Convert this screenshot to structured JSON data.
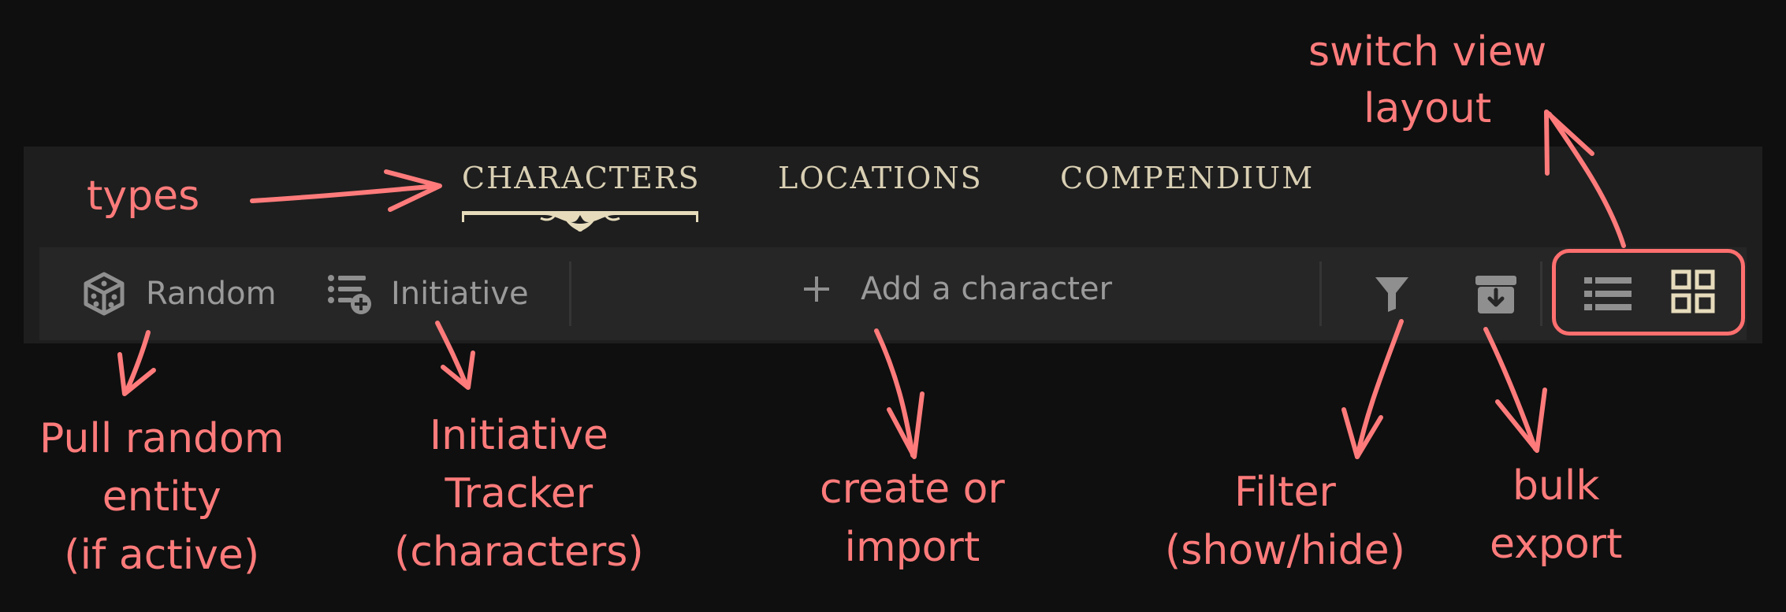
{
  "tabs": {
    "characters": "CHARACTERS",
    "locations": "LOCATIONS",
    "compendium": "COMPENDIUM",
    "active": "characters"
  },
  "toolbar": {
    "random_label": "Random",
    "initiative_label": "Initiative",
    "add_label": "Add a character",
    "icons": {
      "random": "dice-icon",
      "initiative": "list-plus-icon",
      "add": "plus-icon",
      "filter": "filter-icon",
      "export": "archive-download-icon",
      "list_view": "list-view-icon",
      "grid_view": "grid-view-icon"
    }
  },
  "annotations": {
    "types": "types",
    "switch_view": [
      "switch view",
      "layout"
    ],
    "random": [
      "Pull random",
      "entity",
      "(if active)"
    ],
    "initiative": [
      "Initiative",
      "Tracker",
      "(characters)"
    ],
    "create": [
      "create or",
      "import"
    ],
    "filter": [
      "Filter",
      "(show/hide)"
    ],
    "export": [
      "bulk",
      "export"
    ]
  },
  "colors": {
    "background": "#0f0f0f",
    "panel": "#1e1e1e",
    "toolbar": "#262626",
    "tab_text": "#d9cfb3",
    "toolbar_text": "#9a9a9a",
    "accent_cream": "#e6dcbc",
    "annotation": "#ff7b7b"
  }
}
